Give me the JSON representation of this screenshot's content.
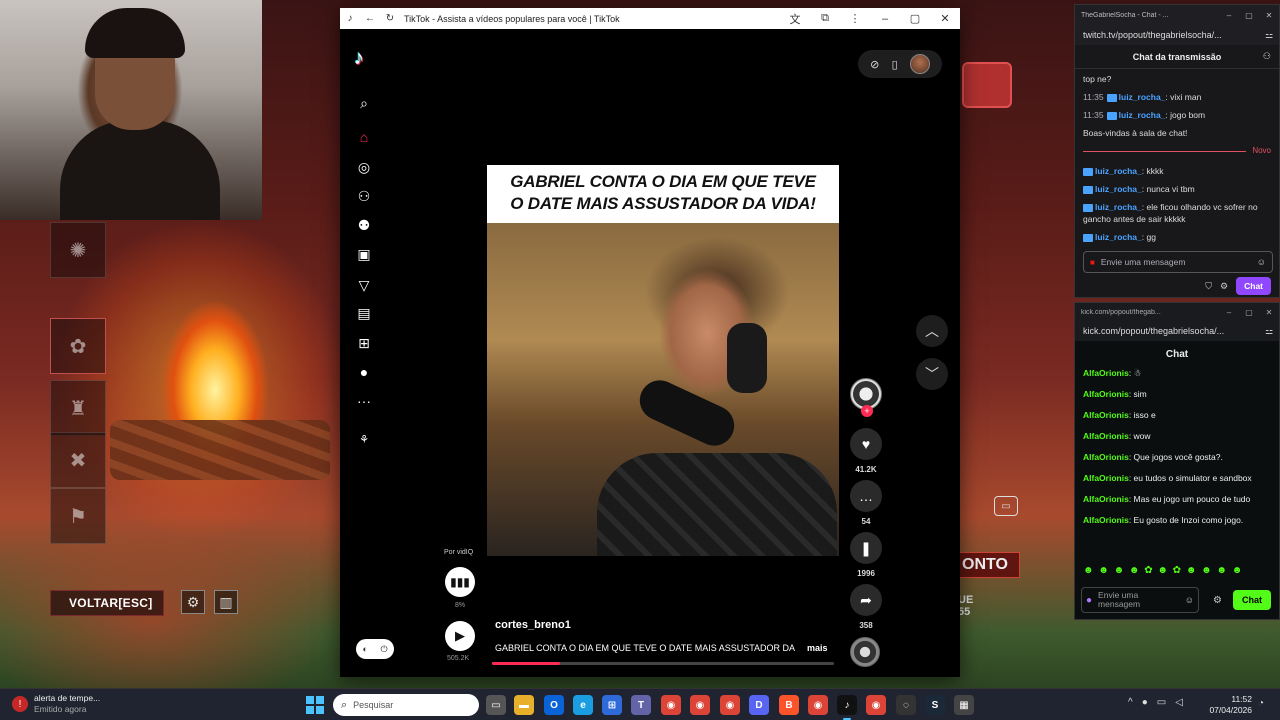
{
  "tiktok": {
    "window_title": "TikTok - Assista a vídeos populares para você | TikTok",
    "video_caption_line1": "GABRIEL CONTA O DIA EM QUE TEVE",
    "video_caption_line2": "O DATE MAIS ASSUSTADOR DA VIDA!",
    "likes": "41.2K",
    "comments": "54",
    "bookmarks": "1996",
    "shares": "358",
    "vidiq_by": "Por vidIQ",
    "vidiq_percent": "8%",
    "play_count": "505.2K",
    "creator": "cortes_breno1",
    "description": "GABRIEL CONTA O DIA EM QUE TEVE O DATE MAIS ASSUSTADOR DA",
    "more_label": "mais",
    "progress": 0.2,
    "accent": "#fe2c55"
  },
  "twitch": {
    "window_title": "TheGabrielSocha - Chat - ...",
    "url": "twitch.tv/popout/thegabrielsocha/...",
    "header": "Chat da transmissão",
    "partial_msg": "top ne?",
    "messages": [
      {
        "time": "11:35",
        "user": "luiz_rocha_",
        "text": ": vixi man"
      },
      {
        "time": "11:35",
        "user": "luiz_rocha_",
        "text": ": jogo bom"
      }
    ],
    "welcome": "Boas-vindas à sala de chat!",
    "new_label": "Novo",
    "new_messages": [
      {
        "user": "luiz_rocha_",
        "text": ": kkkk"
      },
      {
        "user": "luiz_rocha_",
        "text": ": nunca vi tbm"
      },
      {
        "user": "luiz_rocha_",
        "text": ": ele ficou olhando vc sofrer no gancho antes de sair kkkkk"
      },
      {
        "user": "luiz_rocha_",
        "text": ": gg"
      }
    ],
    "input_placeholder": "Envie uma mensagem",
    "chat_button": "Chat",
    "accent": "#9147ff"
  },
  "kick": {
    "window_title": "kick.com/popout/thegab...",
    "url": "kick.com/popout/thegabrielsocha/...",
    "header": "Chat",
    "messages": [
      {
        "user": "AlfaOrionis",
        "text": ":"
      },
      {
        "user": "AlfaOrionis",
        "text": ": sim"
      },
      {
        "user": "AlfaOrionis",
        "text": ": isso e"
      },
      {
        "user": "AlfaOrionis",
        "text": ": wow"
      },
      {
        "user": "AlfaOrionis",
        "text": ": Que jogos você gosta?."
      },
      {
        "user": "AlfaOrionis",
        "text": ": eu tudos o simulator e sandbox"
      },
      {
        "user": "AlfaOrionis",
        "text": ": Mas eu jogo um pouco de tudo"
      },
      {
        "user": "AlfaOrionis",
        "text": ": Eu gosto de Inzoi como jogo."
      }
    ],
    "input_placeholder": "Envie uma mensagem",
    "chat_button": "Chat",
    "accent": "#53fc18"
  },
  "game_hud": {
    "back_label": "VOLTAR",
    "back_key": "[ESC]",
    "ponto_label": "ONTO",
    "ponto_sub1": "UE",
    "ponto_sub2": "55"
  },
  "taskbar": {
    "notif_title": "alerta de tempe...",
    "notif_sub": "Emitido agora",
    "search_placeholder": "Pesquisar",
    "time": "11:52",
    "date": "07/04/2026"
  }
}
